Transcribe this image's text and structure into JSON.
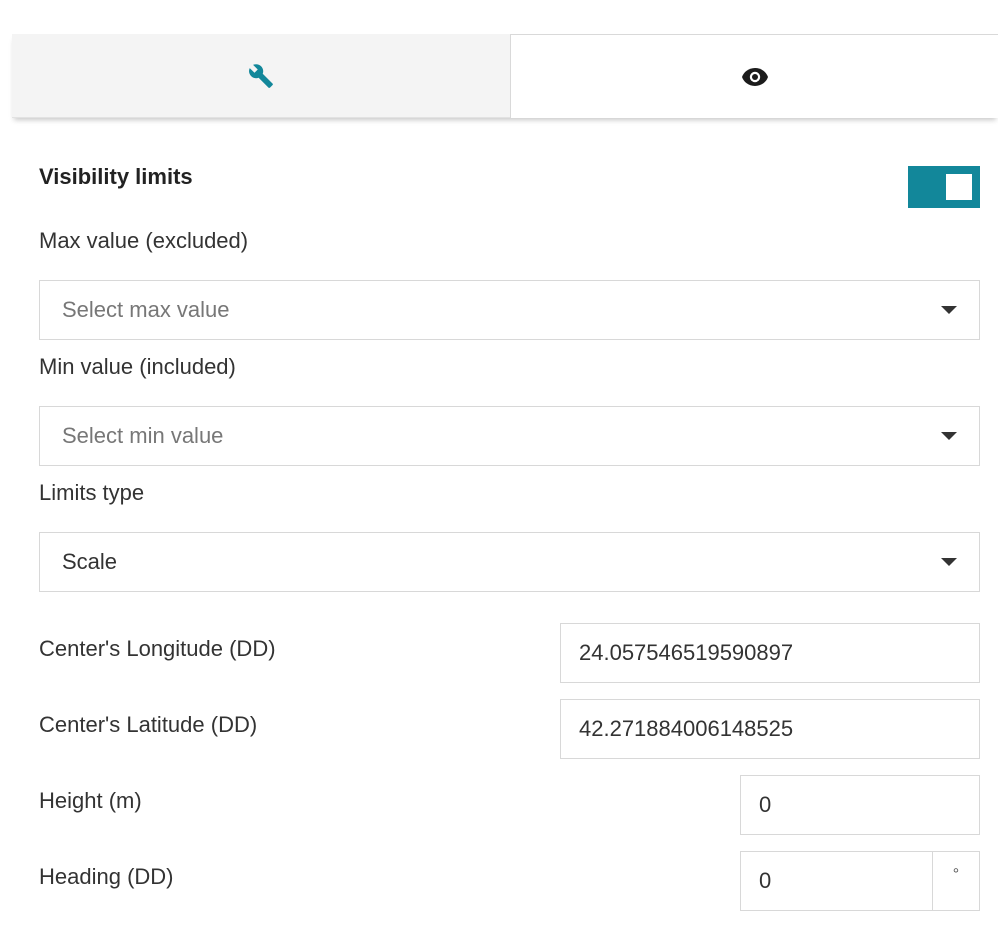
{
  "tabs": [
    {
      "icon": "wrench-icon",
      "active": false
    },
    {
      "icon": "eye-icon",
      "active": true
    }
  ],
  "visibility": {
    "title": "Visibility limits",
    "toggle_on": true,
    "accent_color": "#12879a"
  },
  "max_value": {
    "label": "Max value (excluded)",
    "placeholder": "Select max value"
  },
  "min_value": {
    "label": "Min value (included)",
    "placeholder": "Select min value"
  },
  "limits_type": {
    "label": "Limits type",
    "value": "Scale"
  },
  "center_longitude": {
    "label": "Center's Longitude (DD)",
    "value": "24.057546519590897"
  },
  "center_latitude": {
    "label": "Center's Latitude (DD)",
    "value": "42.271884006148525"
  },
  "height": {
    "label": "Height (m)",
    "value": "0"
  },
  "heading": {
    "label": "Heading (DD)",
    "value": "0",
    "unit": "°"
  }
}
